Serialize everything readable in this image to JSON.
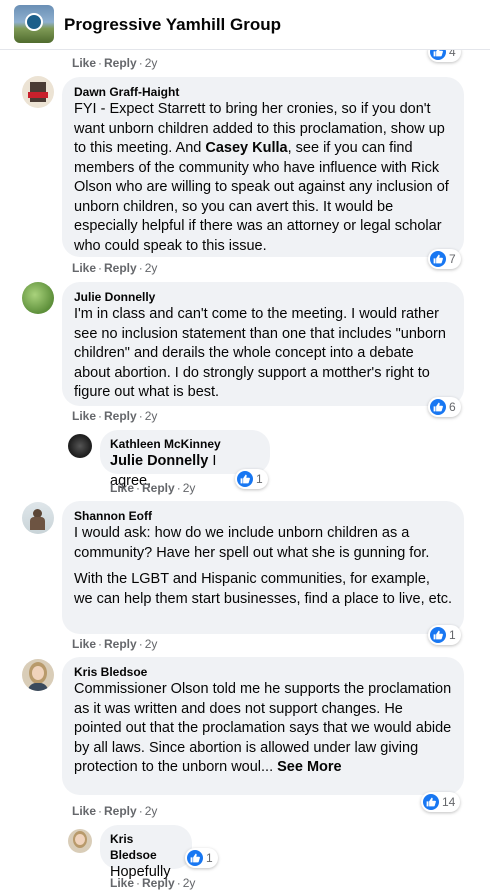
{
  "header": {
    "group_name": "Progressive Yamhill Group",
    "logo_icon": "group-logo-icon"
  },
  "actions": {
    "like": "Like",
    "reply": "Reply",
    "separator": "·"
  },
  "top_stub": {
    "time": "2y",
    "reaction_count": "4"
  },
  "comments": [
    {
      "author": "Dawn Graff-Haight",
      "text_before": "FYI - Expect Starrett to bring her cronies, so if you don't want unborn children added to this proclamation, show up to this meeting. And ",
      "mention": "Casey Kulla",
      "text_after": ", see if you can find members of the community who have influence with Rick Olson who are willing to speak out against any inclusion of unborn children, so you can avert this. It would be especially helpful if there was an attorney or legal scholar who could speak to this issue.",
      "time": "2y",
      "reaction_count": "7"
    },
    {
      "author": "Julie Donnelly",
      "text": "I'm in class and can't come to the meeting. I would rather see no inclusion statement than one that includes \"unborn children\" and derails the whole concept into a debate about abortion. I do strongly support a motther's right to figure out what is best.",
      "time": "2y",
      "reaction_count": "6"
    },
    {
      "author": "Kathleen McKinney",
      "mention": "Julie Donnelly",
      "text": " I agree.",
      "time": "2y",
      "reaction_count": "1"
    },
    {
      "author": "Shannon Eoff",
      "paragraph_1": "I would ask: how do we include unborn children as a community? Have her spell out what she is gunning for.",
      "paragraph_2": "With the LGBT and Hispanic communities, for example, we can help them start businesses, find a place to live, etc.",
      "time": "2y",
      "reaction_count": "1"
    },
    {
      "author": "Kris Bledsoe",
      "text": "Commissioner Olson told me he supports the proclamation as it was written and does not support changes. He pointed out that the proclamation says that we would abide by all laws. Since abortion is allowed under law giving protection to the unborn woul... ",
      "see_more": "See More",
      "time": "2y",
      "reaction_count": "14"
    },
    {
      "author": "Kris Bledsoe",
      "text": "Hopefully",
      "time": "2y",
      "reaction_count": "1"
    }
  ],
  "colors": {
    "reaction_blue": "#1877f2",
    "bubble_bg": "#f0f2f5",
    "meta_gray": "#65676b"
  }
}
